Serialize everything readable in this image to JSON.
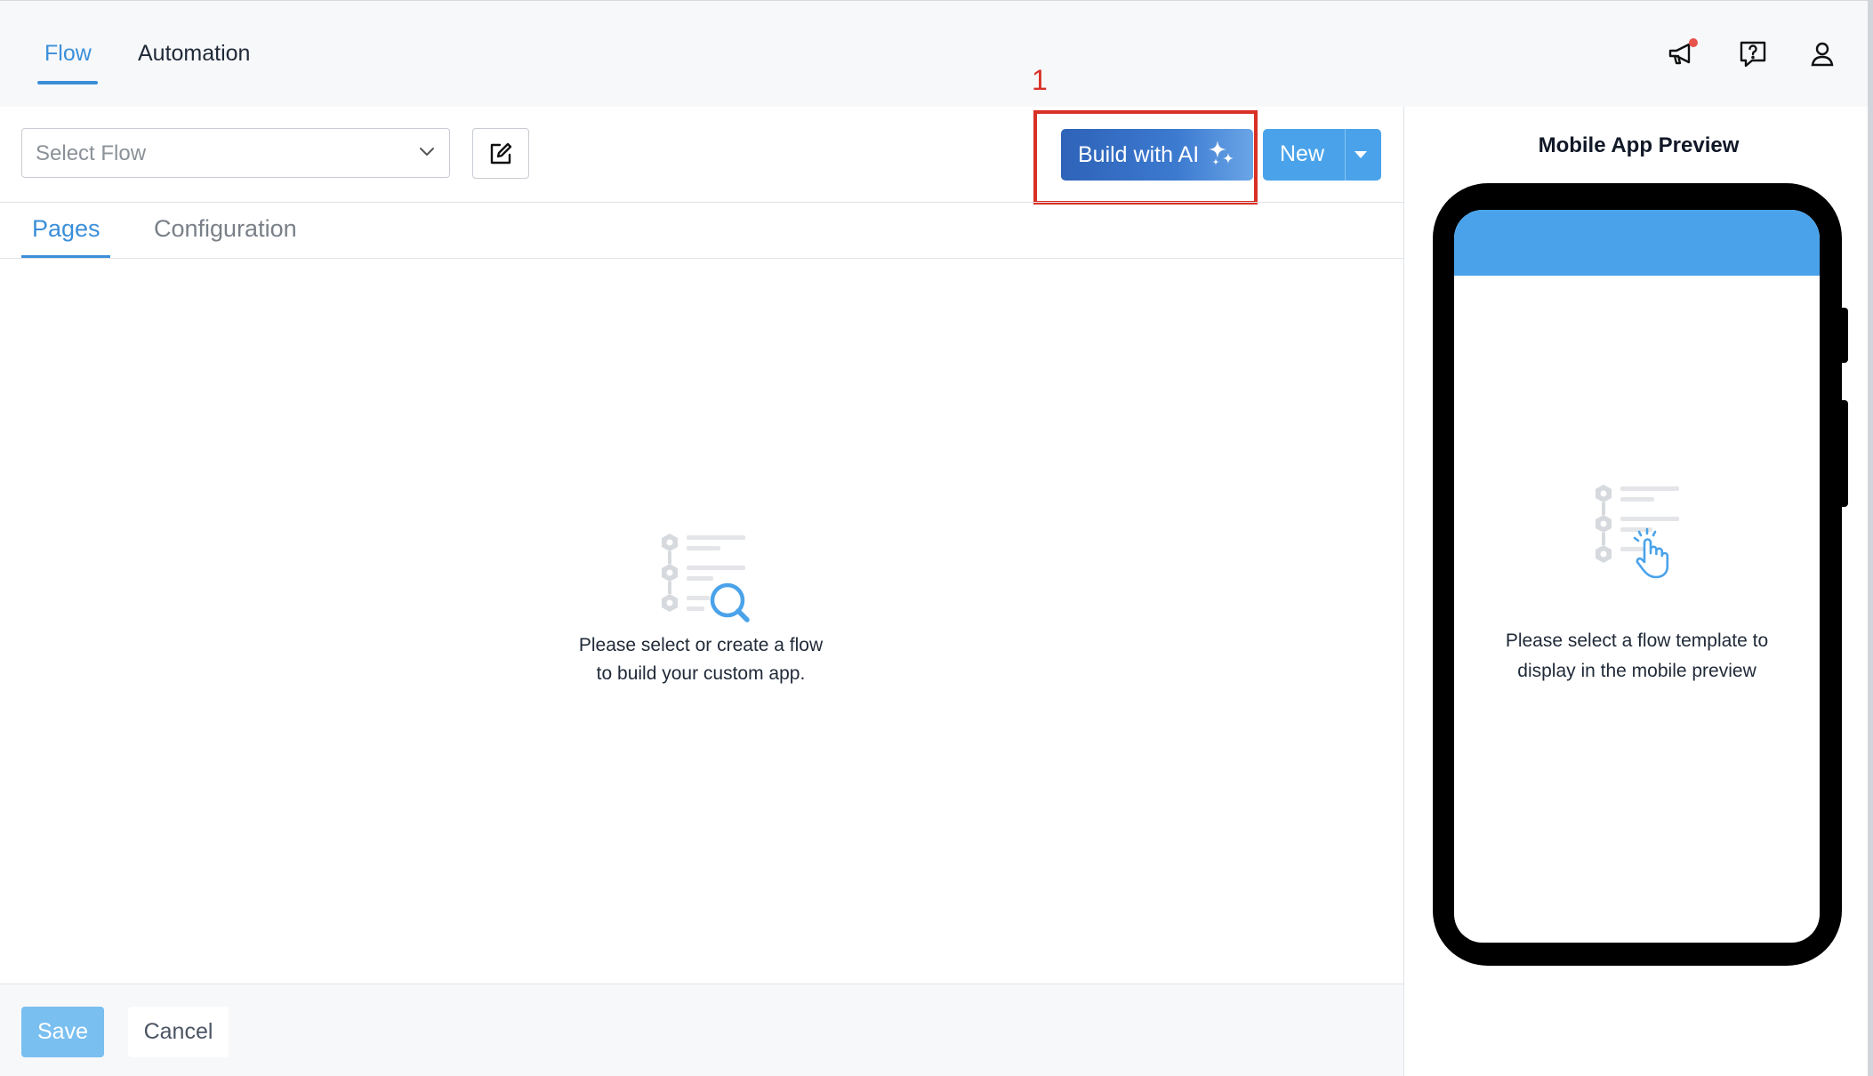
{
  "nav": {
    "tabs": [
      {
        "label": "Flow",
        "active": true
      },
      {
        "label": "Automation",
        "active": false
      }
    ],
    "icons": [
      "megaphone-icon",
      "help-chat-icon",
      "user-icon"
    ]
  },
  "toolbar": {
    "select_placeholder": "Select Flow",
    "build_ai_label": "Build with AI",
    "new_label": "New",
    "annotation_number": "1"
  },
  "tabs": [
    {
      "label": "Pages",
      "active": true
    },
    {
      "label": "Configuration",
      "active": false
    }
  ],
  "empty_state": {
    "line1": "Please select or create a flow",
    "line2": "to build your custom app."
  },
  "footer": {
    "save_label": "Save",
    "cancel_label": "Cancel"
  },
  "preview": {
    "title": "Mobile App Preview",
    "line1": "Please select a flow template to",
    "line2": "display in the mobile preview"
  },
  "colors": {
    "accent": "#3b8fd9",
    "primary_button": "#4aa3ea",
    "ai_gradient_start": "#2e63b8",
    "annotation": "#d93025"
  }
}
